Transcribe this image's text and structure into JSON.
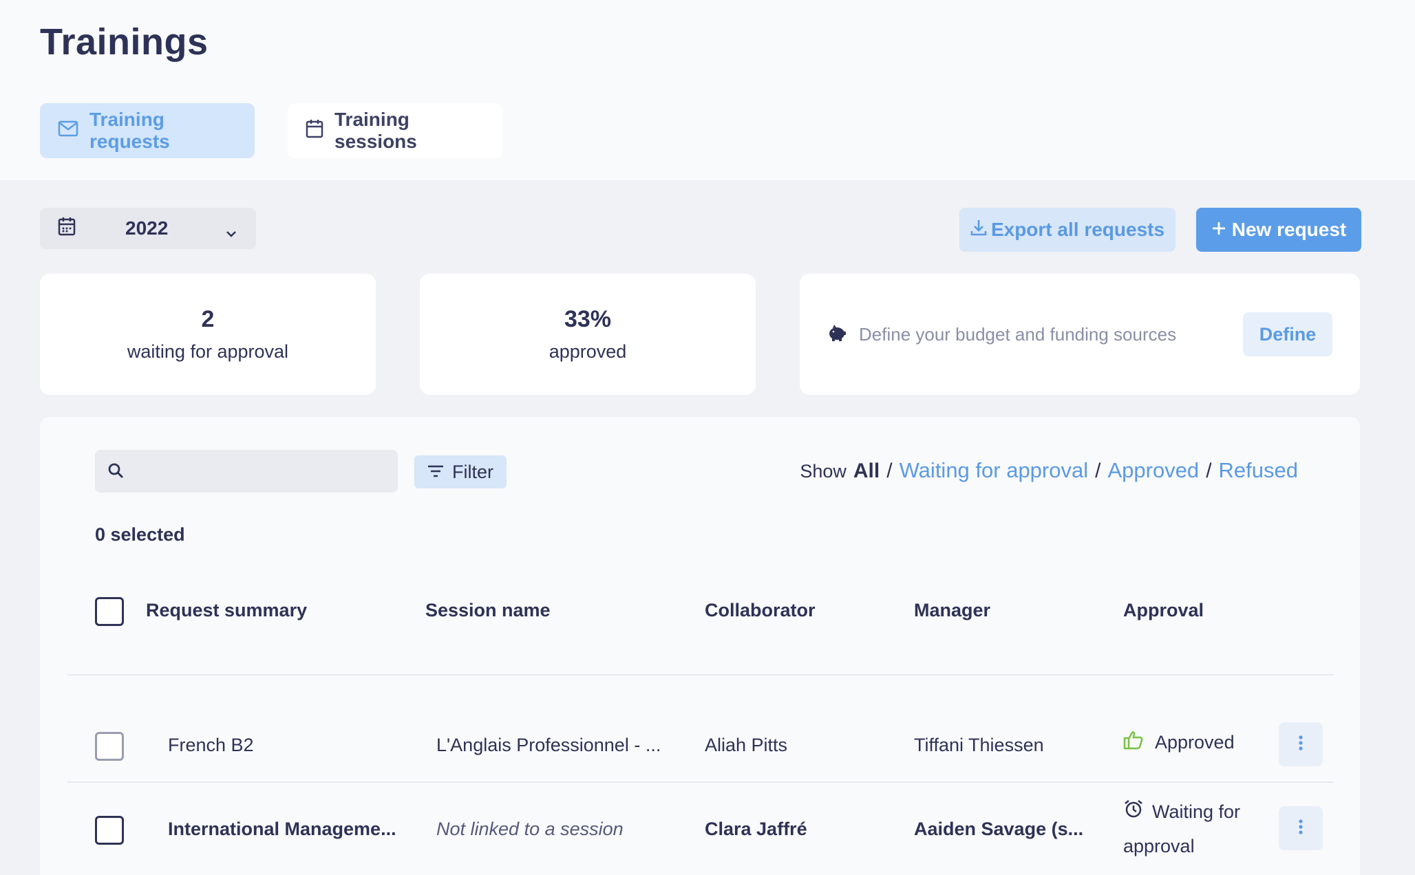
{
  "page": {
    "title": "Trainings"
  },
  "tabs": [
    {
      "label": "Training requests",
      "icon": "mail-icon",
      "active": true
    },
    {
      "label": "Training sessions",
      "icon": "calendar-icon",
      "active": false
    }
  ],
  "toolbar": {
    "year": "2022",
    "export_label": "Export all requests",
    "new_label": "New request"
  },
  "stats": {
    "waiting": {
      "value": "2",
      "label": "waiting for approval"
    },
    "approved": {
      "value": "33%",
      "label": "approved"
    },
    "budget": {
      "text": "Define your budget and funding sources",
      "button": "Define",
      "icon": "piggy-bank-icon"
    }
  },
  "list": {
    "search": {
      "placeholder": "",
      "value": ""
    },
    "filter_label": "Filter",
    "show": {
      "prefix": "Show",
      "all": "All",
      "waiting": "Waiting for approval",
      "approved": "Approved",
      "refused": "Refused"
    },
    "selected_count": "0 selected",
    "columns": {
      "summary": "Request summary",
      "session": "Session name",
      "collaborator": "Collaborator",
      "manager": "Manager",
      "approval": "Approval"
    },
    "rows": [
      {
        "summary": "French B2",
        "session": "L'Anglais Professionnel - ...",
        "collaborator": "Aliah Pitts",
        "manager": "Tiffani Thiessen",
        "approval": "Approved",
        "approval_icon": "thumbs-up-icon"
      },
      {
        "summary": "International Manageme...",
        "session": "Not linked to a session",
        "collaborator": "Clara Jaffré",
        "manager": "Aaiden Savage (s...",
        "approval_line1": "Waiting for",
        "approval_line2": "approval",
        "approval_icon": "alarm-clock-icon"
      }
    ]
  },
  "colors": {
    "accent": "#5b9de9",
    "accent_light": "#d7e6f8",
    "text": "#2e3256",
    "approved_green": "#7ac142"
  }
}
